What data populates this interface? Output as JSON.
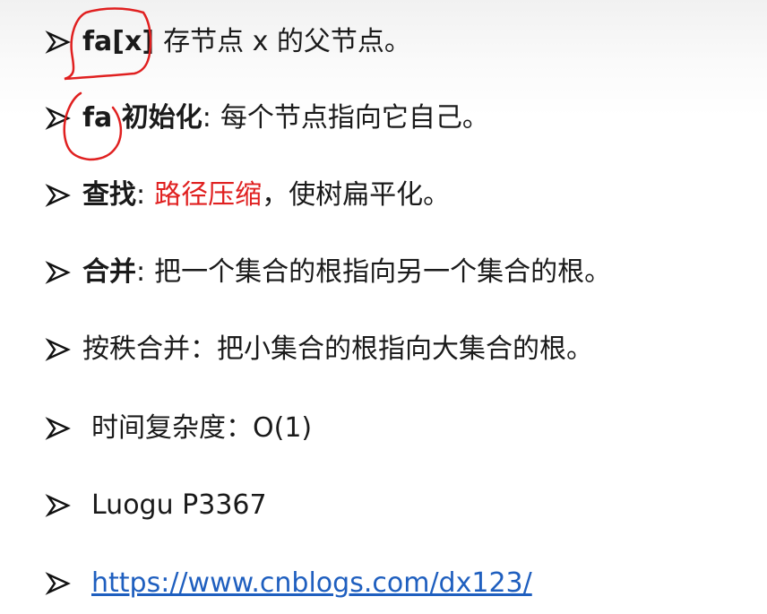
{
  "bullets": [
    {
      "bold": "fa[x]",
      "text": "存节点 x 的父节点。"
    },
    {
      "bold": "fa 初始化",
      "sep": ":",
      "text": "每个节点指向它自己。"
    },
    {
      "bold": "查找",
      "sep": ":",
      "highlight": "路径压缩",
      "text": "，使树扁平化。"
    },
    {
      "bold": "合并",
      "sep": ":",
      "text": "把一个集合的根指向另一个集合的根。"
    },
    {
      "text": "按秩合并：把小集合的根指向大集合的根。"
    },
    {
      "text": "时间复杂度：O(1)"
    },
    {
      "text": "Luogu P3367"
    },
    {
      "link": "https://www.cnblogs.com/dx123/"
    }
  ],
  "colors": {
    "highlight": "#e02020",
    "link": "#1f5fbf",
    "annotation": "#e02020"
  },
  "icons": [
    "arrow-bullet-icon"
  ]
}
